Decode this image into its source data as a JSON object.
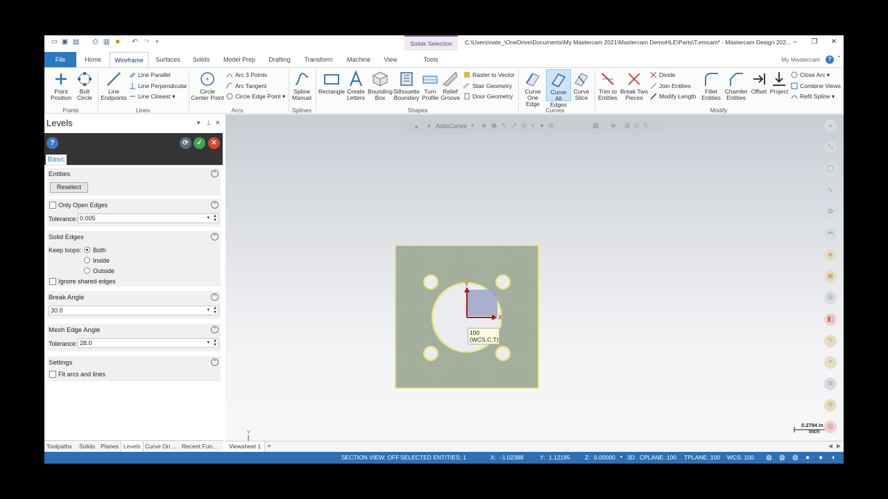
{
  "title": {
    "context_tab": "Solids Selection",
    "path": "C:\\Users\\nate_\\OneDrive\\Documents\\My Mastercam 2021\\Mastercam DemoHLE\\Parts\\T.emcam* - Mastercam Design 202..."
  },
  "ribbon_tabs": [
    "Home",
    "Wireframe",
    "Surfaces",
    "Solids",
    "Model Prep",
    "Drafting",
    "Transform",
    "Machine",
    "View",
    "Tools"
  ],
  "file_tab": "File",
  "my_mastercam": "My Mastercam",
  "ribbon": {
    "point_position": "Point\nPosition",
    "bolt_circle": "Bolt\nCircle",
    "line_endpoints": "Line\nEndpoints",
    "line_parallel": "Line Parallel",
    "line_perpendicular": "Line Perpendicular",
    "line_closest": "Line Closest",
    "circle_center_point": "Circle\nCenter Point",
    "arc_3_points": "Arc 3 Points",
    "arc_tangent": "Arc Tangent",
    "circle_edge_point": "Circle Edge Point",
    "spline_manual": "Spline\nManual",
    "rectangle": "Rectangle",
    "create_letters": "Create\nLetters",
    "bounding_box": "Bounding\nBox",
    "silhouette_boundary": "Silhouette\nBoundary",
    "turn_profile": "Turn\nProfile",
    "relief_groove": "Relief\nGroove",
    "raster_to_vector": "Raster to Vector",
    "stair_geometry": "Stair Geometry",
    "door_geometry": "Door Geometry",
    "curve_one_edge": "Curve\nOne Edge",
    "curve_all_edges": "Curve\nAll Edges",
    "curve_slice": "Curve\nSlice",
    "trim_to_entities": "Trim to\nEntities",
    "break_two_pieces": "Break Two\nPieces",
    "divide": "Divide",
    "join_entities": "Join Entities",
    "modify_length": "Modify Length",
    "fillet_entities": "Fillet\nEntities",
    "chamfer_entities": "Chamfer\nEntities",
    "offset": "Offset",
    "project": "Project",
    "close_arc": "Close Arc",
    "combine_views": "Combine Views",
    "refit_spline": "Refit Spline",
    "groups": {
      "points": "Points",
      "lines": "Lines",
      "arcs": "Arcs",
      "splines": "Splines",
      "shapes": "Shapes",
      "curves": "Curves",
      "modify": "Modify"
    }
  },
  "panel": {
    "title": "Levels",
    "tab": "Basic",
    "entities": {
      "title": "Entities",
      "reselect": "Reselect"
    },
    "open_edges": {
      "label": "Only Open Edges",
      "tolerance_label": "Tolerance:",
      "tolerance": "0.005"
    },
    "solid_edges": {
      "title": "Solid Edges",
      "keep_loops": "Keep loops:",
      "both": "Both",
      "inside": "Inside",
      "outside": "Outside",
      "ignore_shared": "Ignore shared edges"
    },
    "break_angle": {
      "title": "Break Angle",
      "value": "30.0"
    },
    "mesh_edge": {
      "title": "Mesh Edge Angle",
      "tolerance_label": "Tolerance:",
      "value": "28.0"
    },
    "settings": {
      "title": "Settings",
      "fit_arcs": "Fit arcs and lines"
    }
  },
  "panel_tabs": [
    "Toolpaths",
    "Solids",
    "Planes",
    "Levels",
    "Curve On ...",
    "Recent Fun..."
  ],
  "viewport": {
    "autocursor": "AutoCursor",
    "tooltip_line1": "100",
    "tooltip_line2": "(WCS,C,T)",
    "axis_x": "X",
    "axis_y": "Y",
    "level_label": "100",
    "scale_value": "0.2794 in",
    "scale_unit": "Inch"
  },
  "viewsheet": {
    "tab": "Viewsheet 1",
    "add": "+"
  },
  "status": {
    "section_view": "SECTION VIEW: OFF",
    "selected": "SELECTED ENTITIES: 1",
    "x_label": "X:",
    "x": "-1.02388",
    "y_label": "Y:",
    "y": "1.12195",
    "z_label": "Z:",
    "z": "0.00000",
    "mode": "3D",
    "cplane": "CPLANE: 100",
    "tplane": "TPLANE: 100",
    "wcs": "WCS: 100"
  },
  "colors": {
    "accent": "#2b78c2",
    "status_bar": "#2c6fb4",
    "part_fill": "#a7b4a1",
    "highlight": "#f5e97a",
    "axis": "#b01818"
  }
}
